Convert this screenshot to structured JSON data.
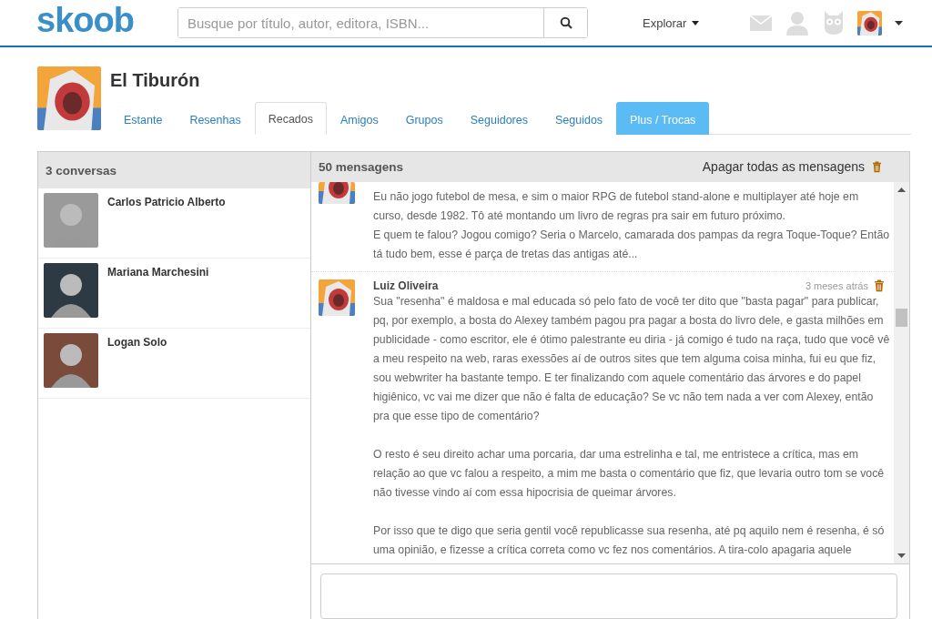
{
  "header": {
    "logo": "skoob",
    "search": {
      "placeholder": "Busque por título, autor, editora, ISBN..."
    },
    "explore": "Explorar"
  },
  "profile": {
    "name": "El Tiburón",
    "tabs": [
      {
        "label": "Estante",
        "selected": false,
        "kind": "tab"
      },
      {
        "label": "Resenhas",
        "selected": false,
        "kind": "tab"
      },
      {
        "label": "Recados",
        "selected": true,
        "kind": "tab"
      },
      {
        "label": "Amigos",
        "selected": false,
        "kind": "tab"
      },
      {
        "label": "Grupos",
        "selected": false,
        "kind": "tab"
      },
      {
        "label": "Seguidores",
        "selected": false,
        "kind": "tab"
      },
      {
        "label": "Seguidos",
        "selected": false,
        "kind": "tab"
      },
      {
        "label": "Plus / Trocas",
        "selected": false,
        "kind": "promo"
      }
    ]
  },
  "conversations": {
    "title": "3 conversas",
    "items": [
      {
        "name": "Carlos Patricio Alberto"
      },
      {
        "name": "Mariana Marchesini"
      },
      {
        "name": "Logan Solo"
      }
    ]
  },
  "messages": {
    "title": "50 mensagens",
    "delete_all": "Apagar todas as mensagens",
    "items": [
      {
        "blocks": [
          [
            "Eu não jogo futebol de mesa, e sim o maior RPG de futebol stand-alone e multiplayer até hoje em curso, desde 1982. Tô até montando um livro de regras pra sair em futuro próximo.",
            "E quem te falou? Jogou comigo? Seria o Marcelo, camarada dos pampas da regra Toque-Toque? Então tá tudo bem, esse é parça de tretas das antigas até..."
          ]
        ]
      },
      {
        "author": "Luiz Oliveira",
        "time": "3 meses atrás",
        "blocks": [
          [
            "Sua \"resenha\" é maldosa e mal educada só pelo fato de você ter dito que \"basta pagar\" para publicar, pq, por exemplo, a bosta do Alexey também pagou pra pagar a bosta do livro dele, e gasta milhões em publicidade - como escritor, ele é ótimo palestrante eu diria - já comigo é tudo na raça, tudo que você vê a meu respeito na web, raras exessões aí de outros sites que tem alguma coisa minha, fui eu que fiz, sou webwriter ha bastante tempo. E ter finalizando com aquele comentário das árvores e do papel higiênico, vc vai me dizer que não é falta de educação? Se vc não tem nada a ver com Alexey, então pra que esse tipo de comentário?"
          ],
          [
            "O resto é seu direito achar uma porcaria, dar uma estrelinha e tal, me entristece a crítica, mas em relação ao que vc falou a respeito, a mim me basta o comentário que fiz, que levaria outro tom se você não tivesse vindo aí com essa hipocrisia de queimar árvores."
          ],
          [
            "Por isso que te digo que seria gentil você republicasse sua resenha, até pq aquilo nem é resenha, é só uma opinião, e fizesse a crítica correta como vc fez nos comentários. A tira-colo apagaria aquele"
          ]
        ]
      }
    ]
  }
}
